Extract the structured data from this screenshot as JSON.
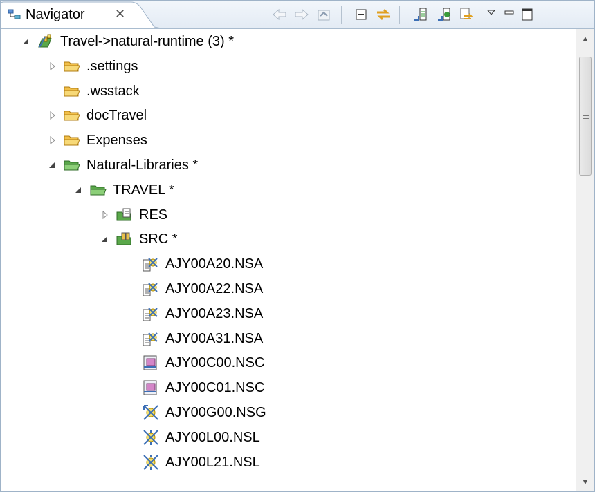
{
  "tab": {
    "title": "Navigator",
    "close_glyph": "✕",
    "icon": "navigator-icon"
  },
  "toolbar": {
    "buttons": [
      "back-icon",
      "forward-icon",
      "go-up-icon",
      "collapse-all-icon",
      "link-with-editor-icon",
      "upload-icon",
      "download-icon",
      "refresh-sync-icon",
      "view-menu-icon",
      "minimize-icon",
      "maximize-icon"
    ]
  },
  "tree": [
    {
      "label": "Travel->natural-runtime (3) *",
      "level": 0,
      "state": "expanded",
      "icon": "project-icon"
    },
    {
      "label": ".settings",
      "level": 1,
      "state": "collapsed",
      "icon": "folder-icon"
    },
    {
      "label": ".wsstack",
      "level": 1,
      "state": "none",
      "icon": "folder-icon"
    },
    {
      "label": "docTravel",
      "level": 1,
      "state": "collapsed",
      "icon": "folder-icon"
    },
    {
      "label": "Expenses",
      "level": 1,
      "state": "collapsed",
      "icon": "folder-icon"
    },
    {
      "label": "Natural-Libraries *",
      "level": 1,
      "state": "expanded",
      "icon": "green-folder-icon"
    },
    {
      "label": "TRAVEL *",
      "level": 2,
      "state": "expanded",
      "icon": "green-folder-icon"
    },
    {
      "label": "RES",
      "level": 3,
      "state": "collapsed",
      "icon": "resource-folder-icon"
    },
    {
      "label": "SRC *",
      "level": 3,
      "state": "expanded",
      "icon": "source-folder-icon"
    },
    {
      "label": "AJY00A20.NSA",
      "level": 4,
      "state": "none",
      "icon": "nsa-file-icon"
    },
    {
      "label": "AJY00A22.NSA",
      "level": 4,
      "state": "none",
      "icon": "nsa-file-icon"
    },
    {
      "label": "AJY00A23.NSA",
      "level": 4,
      "state": "none",
      "icon": "nsa-file-icon"
    },
    {
      "label": "AJY00A31.NSA",
      "level": 4,
      "state": "none",
      "icon": "nsa-file-icon"
    },
    {
      "label": "AJY00C00.NSC",
      "level": 4,
      "state": "none",
      "icon": "nsc-file-icon"
    },
    {
      "label": "AJY00C01.NSC",
      "level": 4,
      "state": "none",
      "icon": "nsc-file-icon"
    },
    {
      "label": "AJY00G00.NSG",
      "level": 4,
      "state": "none",
      "icon": "nsg-file-icon"
    },
    {
      "label": "AJY00L00.NSL",
      "level": 4,
      "state": "none",
      "icon": "nsl-file-icon"
    },
    {
      "label": "AJY00L21.NSL",
      "level": 4,
      "state": "none",
      "icon": "nsl-file-icon"
    }
  ],
  "colors": {
    "folder": "#f2c04a",
    "green_folder": "#5aa84a",
    "accent": "#3c6fb6"
  }
}
